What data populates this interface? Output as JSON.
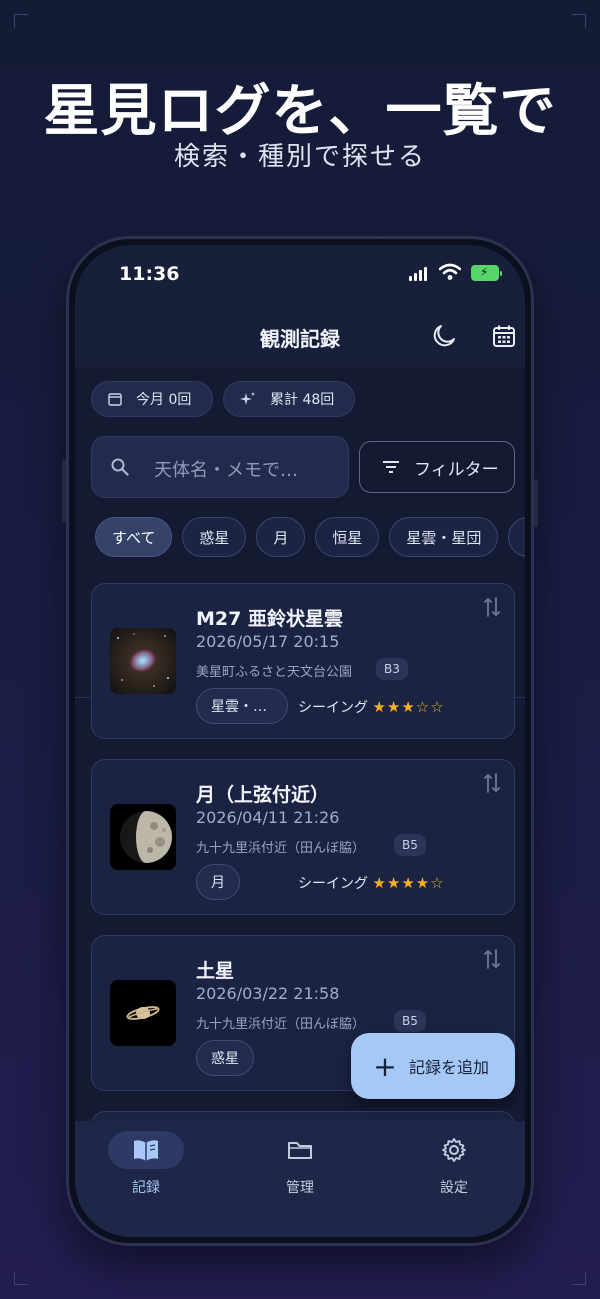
{
  "promo": {
    "headline": "星見ログを、一覧で",
    "subheadline": "検索・種別で探せる"
  },
  "status_bar": {
    "time": "11:36"
  },
  "app_bar": {
    "title": "観測記録",
    "icons": [
      "moon-icon",
      "calendar-icon"
    ]
  },
  "stats": {
    "this_month": "今月 0回",
    "total": "累計 48回"
  },
  "search": {
    "placeholder": "天体名・メモで…"
  },
  "filter": {
    "label": "フィルター"
  },
  "categories": [
    {
      "label": "すべて",
      "active": true
    },
    {
      "label": "惑星",
      "active": false
    },
    {
      "label": "月",
      "active": false
    },
    {
      "label": "恒星",
      "active": false
    },
    {
      "label": "星雲・星団",
      "active": false
    },
    {
      "label": "彗",
      "active": false
    }
  ],
  "records": [
    {
      "title": "M27 亜鈴状星雲",
      "datetime": "2026/05/17 20:15",
      "place": "美星町ふるさと天文台公園",
      "badge": "B3",
      "tag": "星雲・…",
      "seeing_label": "シーイング",
      "seeing_stars": "★★★☆☆",
      "seeing_rating": 3
    },
    {
      "title": "月（上弦付近）",
      "datetime": "2026/04/11 21:26",
      "place": "九十九里浜付近（田んぼ脇）",
      "badge": "B5",
      "tag": "月",
      "seeing_label": "シーイング",
      "seeing_stars": "★★★★☆",
      "seeing_rating": 4
    },
    {
      "title": "土星",
      "datetime": "2026/03/22 21:58",
      "place": "九十九里浜付近（田んぼ脇）",
      "badge": "B5",
      "tag": "惑星"
    }
  ],
  "fab": {
    "label": "記録を追加"
  },
  "nav": [
    {
      "label": "記録",
      "icon": "book-icon",
      "active": true
    },
    {
      "label": "管理",
      "icon": "folder-icon",
      "active": false
    },
    {
      "label": "設定",
      "icon": "gear-icon",
      "active": false
    }
  ],
  "colors": {
    "accent": "#a6c8f5",
    "star": "#f5b021",
    "surface": "#1b2342",
    "background": "#131a32"
  }
}
